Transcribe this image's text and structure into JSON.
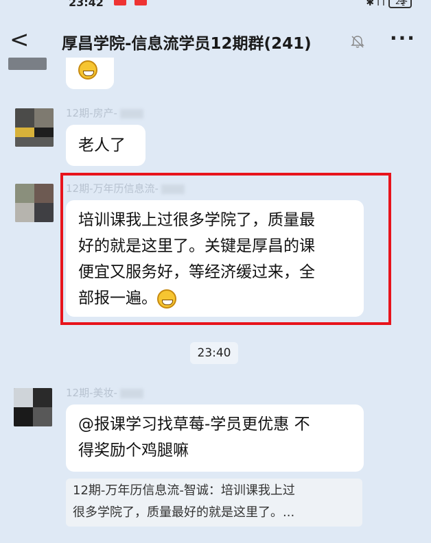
{
  "status": {
    "time": "23:42",
    "battery": "23"
  },
  "header": {
    "title": "厚昌学院-信息流学员12期群(241)",
    "back_glyph": "<",
    "more_glyph": "···"
  },
  "messages": [
    {
      "sender": "12期-房产-",
      "text": "老人了"
    },
    {
      "sender": "12期-万年历信息流-",
      "lines": [
        "培训课我上过很多学院了，质量最",
        "好的就是这里了。关键是厚昌的课",
        "便宜又服务好，等经济缓过来，全",
        "部报一遍。"
      ]
    },
    {
      "sender": "12期-美妆-",
      "lines": [
        "@报课学习找草莓-学员更优惠 不",
        "得奖励个鸡腿嘛"
      ],
      "quote_lines": [
        "12期-万年历信息流-智诚：培训课我上过",
        "很多学院了，质量最好的就是这里了。..."
      ]
    }
  ],
  "time_divider": "23:40",
  "icons": [
    "back-icon",
    "mute-bell-icon",
    "more-icon",
    "grin-emoji-icon"
  ],
  "colors": {
    "background": "#dfe9f5",
    "highlight": "#e8141c",
    "bubble": "#ffffff"
  }
}
